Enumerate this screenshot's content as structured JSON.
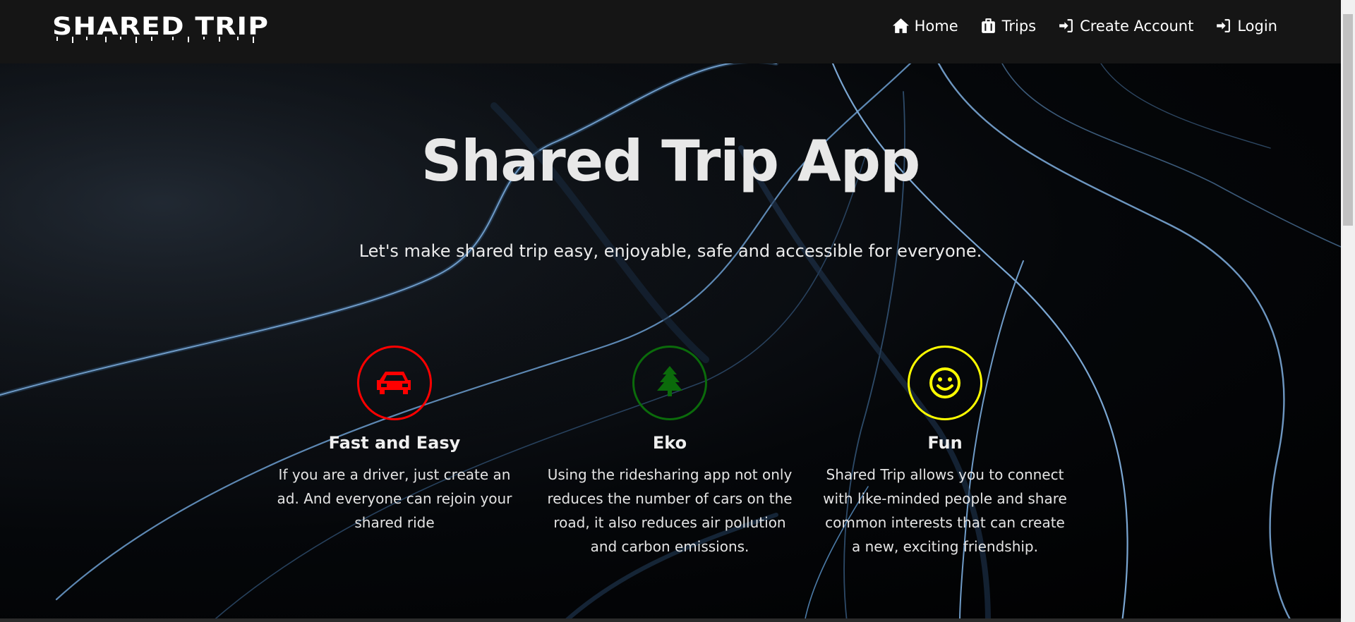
{
  "brand": {
    "logo_text": "SHARED TRIP"
  },
  "nav": {
    "items": [
      {
        "label": "Home",
        "icon": "home-icon"
      },
      {
        "label": "Trips",
        "icon": "suitcase-icon"
      },
      {
        "label": "Create Account",
        "icon": "sign-in-icon"
      },
      {
        "label": "Login",
        "icon": "sign-in-icon"
      }
    ]
  },
  "hero": {
    "title": "Shared Trip App",
    "subtitle": "Let's make shared trip easy, enjoyable, safe and accessible for everyone."
  },
  "features": [
    {
      "title": "Fast and Easy",
      "description": "If you are a driver, just create an ad. And everyone can rejoin your shared ride",
      "icon": "car-icon",
      "color": "#ff0000"
    },
    {
      "title": "Eko",
      "description": "Using the ridesharing app not only reduces the number of cars on the road, it also reduces air pollution and carbon emissions.",
      "icon": "tree-icon",
      "color": "#0b6b0b"
    },
    {
      "title": "Fun",
      "description": "Shared Trip allows you to connect with like-minded people and share common interests that can create a new, exciting friendship.",
      "icon": "smile-icon",
      "color": "#ffff00"
    }
  ],
  "colors": {
    "navbar": "#151515",
    "background": "#000000",
    "line_accent": "#4d7fb0"
  }
}
